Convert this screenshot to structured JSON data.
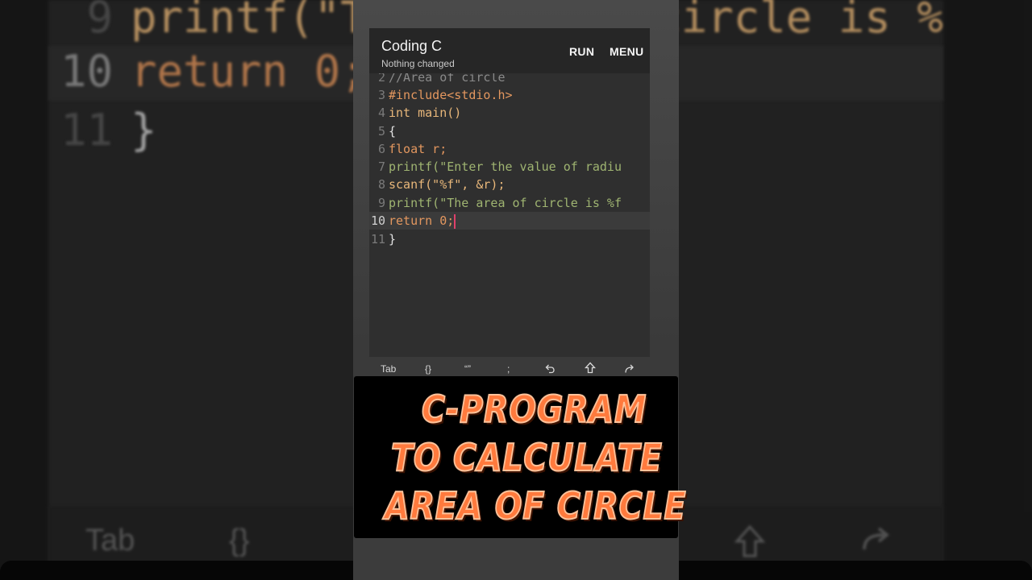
{
  "app": {
    "title": "Coding C",
    "subtitle": "Nothing changed",
    "run_label": "RUN",
    "menu_label": "MENU"
  },
  "code_lines": [
    {
      "n": "2",
      "text": "//Area of circle"
    },
    {
      "n": "3",
      "text": "#include<stdio.h>"
    },
    {
      "n": "4",
      "text": "int main()"
    },
    {
      "n": "5",
      "text": "{"
    },
    {
      "n": "6",
      "text": "float r;"
    },
    {
      "n": "7",
      "text": "printf(\"Enter the value of radiu"
    },
    {
      "n": "8",
      "text": "scanf(\"%f\", &r);"
    },
    {
      "n": "9",
      "text": "printf(\"The area of circle is %f"
    },
    {
      "n": "10",
      "text": "return 0;"
    },
    {
      "n": "11",
      "text": "}"
    }
  ],
  "keys": {
    "tab": "Tab",
    "braces": "{}",
    "quotes": "“”",
    "semicolon": ";",
    "undo_icon": "undo-icon",
    "shift_icon": "shift-icon",
    "redo_icon": "redo-icon"
  },
  "background": {
    "line9_num": "9",
    "line9_text": "printf(\"The area of circle is %f",
    "line10_num": "10",
    "line10_text": "return 0;",
    "line11_num": "11",
    "line11_text": "}",
    "key_tab": "Tab",
    "key_braces": "{}"
  },
  "banner": {
    "line1": "C-PROGRAM",
    "line2": "TO CALCULATE",
    "line3": "AREA OF CIRCLE"
  },
  "colors": {
    "accent_orange": "#ff7a3d",
    "cursor": "#e0406a",
    "string_green": "#9fb471"
  }
}
